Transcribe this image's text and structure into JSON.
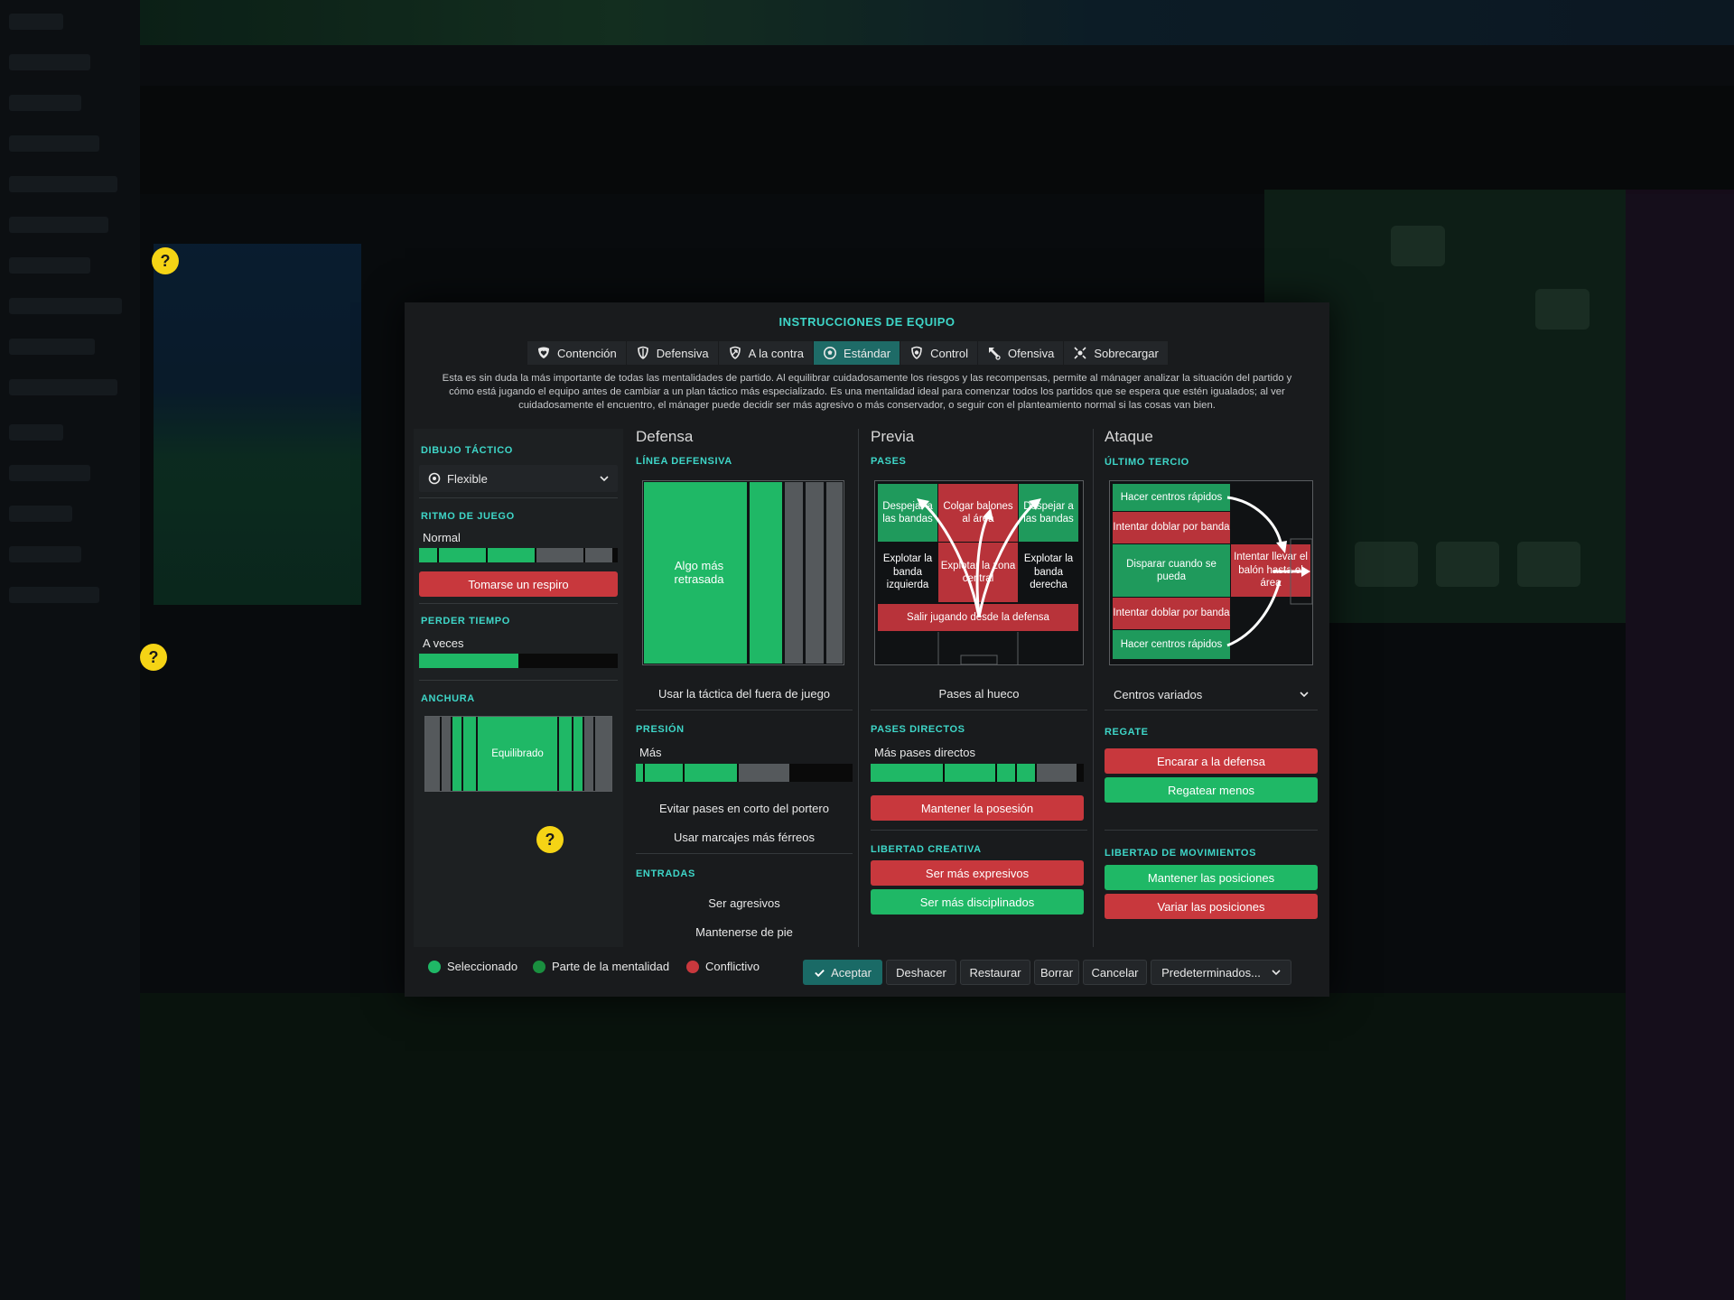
{
  "dialog": {
    "title": "INSTRUCCIONES DE EQUIPO",
    "tabs": [
      {
        "label": "Contención",
        "icon": "shield-heart-icon"
      },
      {
        "label": "Defensiva",
        "icon": "shield-icon"
      },
      {
        "label": "A la contra",
        "icon": "counter-icon"
      },
      {
        "label": "Estándar",
        "icon": "ball-icon",
        "active": true
      },
      {
        "label": "Control",
        "icon": "control-icon"
      },
      {
        "label": "Ofensiva",
        "icon": "attack-icon"
      },
      {
        "label": "Sobrecargar",
        "icon": "overload-icon"
      }
    ],
    "description": "Esta es sin duda la más importante de todas las mentalidades de partido. Al equilibrar cuidadosamente los riesgos y las recompensas, permite al mánager analizar la situación del partido y cómo está jugando el equipo antes de cambiar a un plan táctico más especializado. Es una mentalidad ideal para comenzar todos los partidos que se espera que estén igualados; al ver cuidadosamente el encuentro, el mánager puede decidir ser más agresivo o más conservador, o seguir con el planteamiento normal si las cosas van bien."
  },
  "left": {
    "dibujo_title": "DIBUJO TÁCTICO",
    "dibujo_value": "Flexible",
    "ritmo_title": "RITMO DE JUEGO",
    "ritmo_value": "Normal",
    "ritmo_level": 0.6,
    "ritmo_button": "Tomarse un respiro",
    "perder_title": "PERDER TIEMPO",
    "perder_value": "A veces",
    "perder_level": 0.5,
    "anchura_title": "ANCHURA",
    "anchura_value": "Equilibrado"
  },
  "defensa": {
    "head": "Defensa",
    "linea_title": "LÍNEA DEFENSIVA",
    "linea_value": "Algo más retrasada",
    "offside": "Usar la táctica del fuera de juego",
    "presion_title": "PRESIÓN",
    "presion_value": "Más",
    "presion_level": 0.75,
    "opt1": "Evitar pases en corto del portero",
    "opt2": "Usar marcajes más férreos",
    "entradas_title": "ENTRADAS",
    "entradas1": "Ser agresivos",
    "entradas2": "Mantenerse de pie"
  },
  "previa": {
    "head": "Previa",
    "pases_title": "PASES",
    "cells": {
      "tl": "Despejar a las bandas",
      "tm": "Colgar balones al área",
      "tr": "Despejar a las bandas",
      "ml": "Explotar la banda izquierda",
      "mm": "Explotar la zona central",
      "mr": "Explotar la banda derecha",
      "bottom": "Salir jugando desde la defensa"
    },
    "hueco": "Pases al hueco",
    "directos_title": "PASES DIRECTOS",
    "directos_value": "Más pases directos",
    "directos_level": 0.88,
    "posesion_button": "Mantener la posesión",
    "libertad_title": "LIBERTAD CREATIVA",
    "expresivos_button": "Ser más expresivos",
    "disciplinados_button": "Ser más disciplinados"
  },
  "ataque": {
    "head": "Ataque",
    "tercio_title": "ÚLTIMO TERCIO",
    "cells": {
      "c1": "Hacer centros rápidos",
      "c2": "Intentar doblar por banda",
      "c3": "Disparar cuando se pueda",
      "c4": "Intentar llevar el balón hasta el área",
      "c5": "Intentar doblar por banda",
      "c6": "Hacer centros rápidos"
    },
    "centros_value": "Centros variados",
    "regate_title": "REGATE",
    "encarar_button": "Encarar a la defensa",
    "regatear_button": "Regatear menos",
    "movimientos_title": "LIBERTAD DE MOVIMIENTOS",
    "mantener_button": "Mantener las posiciones",
    "variar_button": "Variar las posiciones"
  },
  "footer": {
    "legend_selected": "Seleccionado",
    "legend_part": "Parte de la mentalidad",
    "legend_conflict": "Conflictivo",
    "accept": "Aceptar",
    "undo": "Deshacer",
    "restore": "Restaurar",
    "clear": "Borrar",
    "cancel": "Cancelar",
    "defaults": "Predeterminados..."
  },
  "colors": {
    "accent": "#3ed6c8",
    "selected": "#1fb866",
    "part": "#1a8f3f",
    "conflict": "#c8383d",
    "help": "#f5d415"
  },
  "help": {
    "symbol": "?"
  }
}
